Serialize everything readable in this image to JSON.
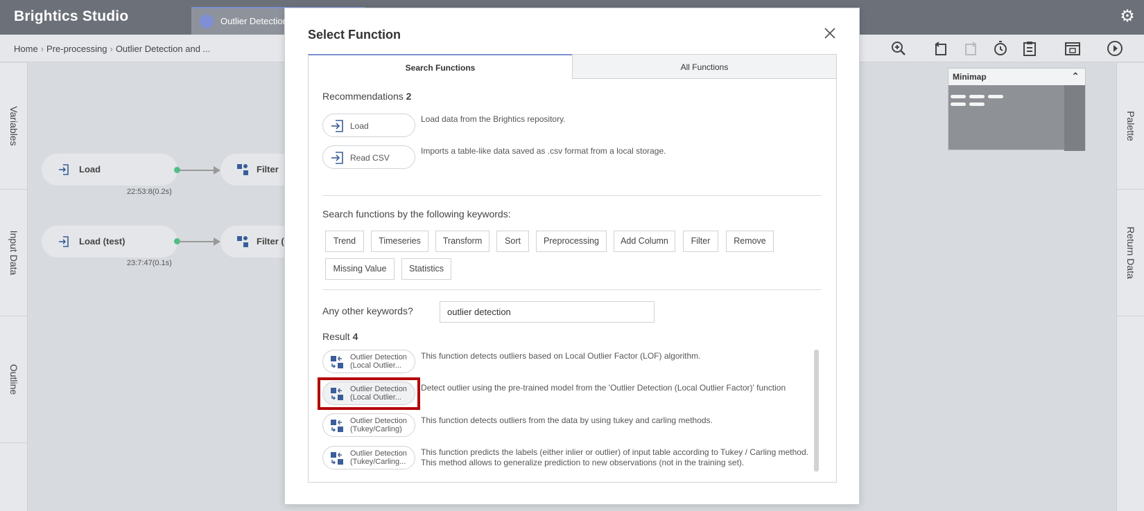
{
  "app": {
    "title": "Brightics Studio"
  },
  "tab": {
    "label": "Outlier Detection"
  },
  "breadcrumb": {
    "home": "Home",
    "level1": "Pre-processing",
    "level2": "Outlier Detection and ..."
  },
  "left_panel": {
    "tabs": [
      "Variables",
      "Input Data",
      "Outline"
    ]
  },
  "right_panel": {
    "tabs": [
      "Palette",
      "Return Data"
    ]
  },
  "canvas": {
    "nodes": [
      {
        "label": "Load",
        "time": "22:53:8(0.2s)"
      },
      {
        "label": "Filter"
      },
      {
        "label": "Load (test)",
        "time": "23:7:47(0.1s)"
      },
      {
        "label": "Filter (t"
      }
    ]
  },
  "minimap": {
    "title": "Minimap"
  },
  "modal": {
    "title": "Select Function",
    "tabs": {
      "search": "Search Functions",
      "all": "All Functions"
    },
    "recommendations": {
      "label": "Recommendations",
      "count": "2",
      "items": [
        {
          "name": "Load",
          "desc": "Load data from the Brightics repository."
        },
        {
          "name": "Read CSV",
          "desc": "Imports a table-like data saved as .csv format from a local storage."
        }
      ]
    },
    "keywords": {
      "label": "Search functions by the following keywords:",
      "items": [
        "Trend",
        "Timeseries",
        "Transform",
        "Sort",
        "Preprocessing",
        "Add Column",
        "Filter",
        "Remove",
        "Missing Value",
        "Statistics"
      ]
    },
    "other": {
      "label": "Any other keywords?",
      "value": "outlier detection"
    },
    "result": {
      "label": "Result",
      "count": "4",
      "items": [
        {
          "line1": "Outlier Detection",
          "line2": "(Local Outlier...",
          "desc": "This function detects outliers based on Local Outlier Factor (LOF) algorithm.",
          "desc2": ""
        },
        {
          "line1": "Outlier Detection",
          "line2": "(Local Outlier...",
          "desc": "Detect outlier using the pre-trained model from the 'Outlier Detection (Local Outlier Factor)' function",
          "desc2": ""
        },
        {
          "line1": "Outlier Detection",
          "line2": "(Tukey/Carling)",
          "desc": "This function detects outliers from the data by using tukey and carling methods.",
          "desc2": ""
        },
        {
          "line1": "Outlier Detection",
          "line2": "(Tukey/Carling...",
          "desc": "This function predicts the labels (either inlier or outlier) of input table according to Tukey / Carling method.",
          "desc2": "This method allows to generalize prediction to new observations (not in the training set)."
        }
      ]
    }
  },
  "icons": {
    "settings": "gear-icon",
    "close": "close-icon",
    "load": "load-arrow-icon",
    "function": "outlier-function-icon",
    "filter": "filter-icon",
    "toolbar": [
      "zoom-in-icon",
      "undo-icon",
      "redo-icon",
      "history-icon",
      "clipboard-icon",
      "layout-icon",
      "run-icon"
    ]
  },
  "colors": {
    "topbar": "#6b7079",
    "accent": "#7a8fd0",
    "highlight": "#b3070a",
    "port": "#4fbf86",
    "icon_blue": "#3a5e9a"
  }
}
